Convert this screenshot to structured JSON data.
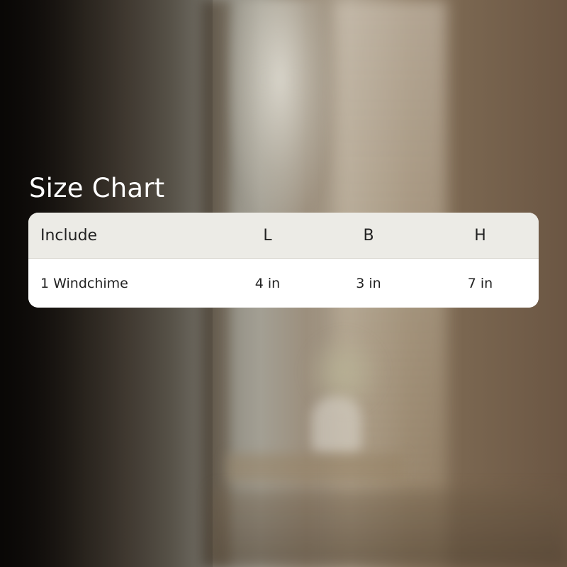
{
  "size_chart": {
    "title": "Size Chart",
    "columns": [
      "Include",
      "L",
      "B",
      "H"
    ],
    "rows": [
      [
        "1 Windchime",
        "4 in",
        "3 in",
        "7 in"
      ]
    ]
  }
}
